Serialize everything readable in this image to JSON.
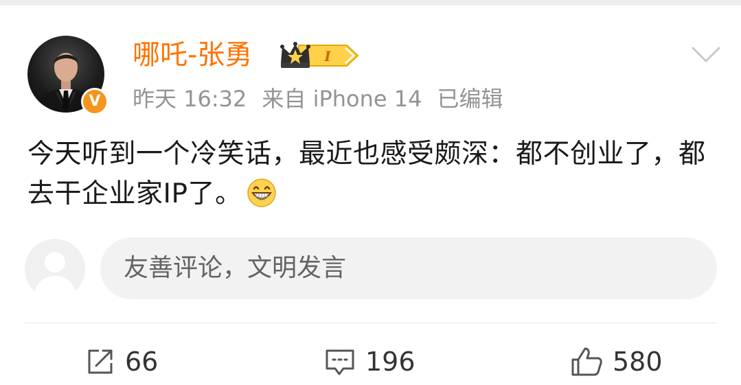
{
  "post": {
    "username": "哪吒-张勇",
    "verified_mark": "V",
    "badge_level": "I",
    "time": "昨天 16:32",
    "source": "来自 iPhone 14",
    "edited": "已编辑",
    "content": "今天听到一个冷笑话，最近也感受颇深：都不创业了，都去干企业家IP了。",
    "emoji": "grinning-face"
  },
  "comment_box": {
    "placeholder": "友善评论，文明发言"
  },
  "actions": {
    "repost_count": "66",
    "comment_count": "196",
    "like_count": "580"
  },
  "colors": {
    "username": "#ff7300",
    "verified": "#f7941d",
    "meta": "#939393"
  }
}
